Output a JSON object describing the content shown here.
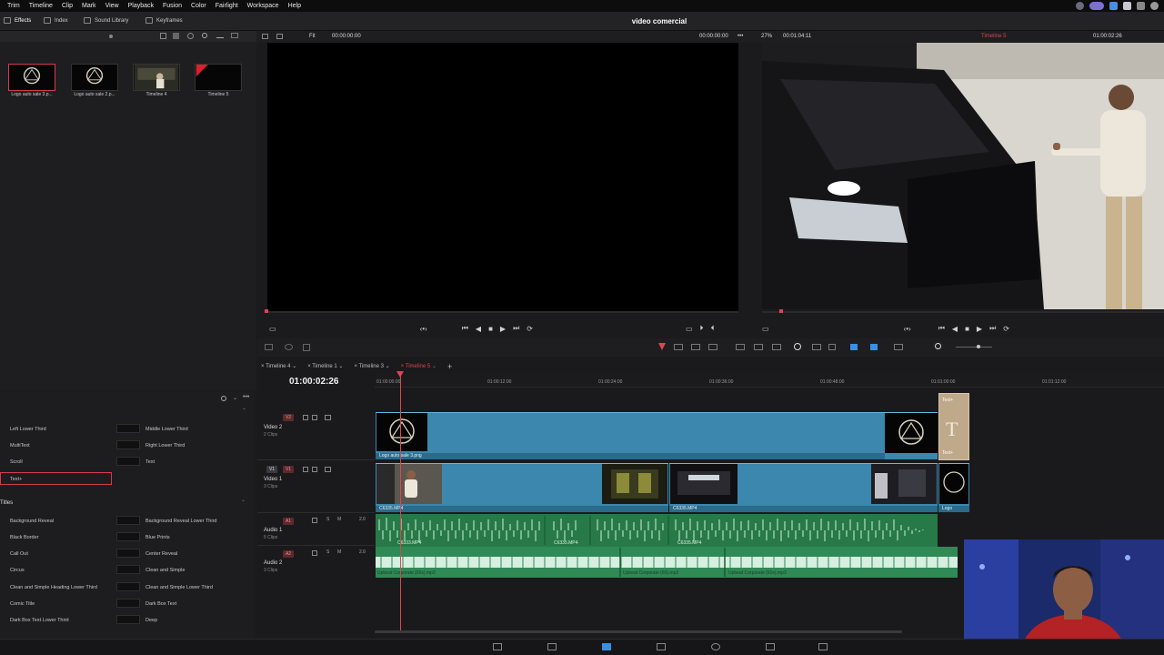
{
  "menu": [
    "Trim",
    "Timeline",
    "Clip",
    "Mark",
    "View",
    "Playback",
    "Fusion",
    "Color",
    "Fairlight",
    "Workspace",
    "Help"
  ],
  "toolbar": {
    "effects": "Effects",
    "index": "Index",
    "sound_library": "Sound Library",
    "keyframes": "Keyframes"
  },
  "project_title": "video comercial",
  "media_pool": {
    "clips": [
      {
        "label": "Logo auto sale 3.p..."
      },
      {
        "label": "Logo auto sale 2.p..."
      },
      {
        "label": "Timeline 4"
      },
      {
        "label": "Timeline 5"
      }
    ]
  },
  "viewer": {
    "fit": "Fit",
    "source_tc": "00:00:00:00",
    "prog_tc_left": "00:00:00:00",
    "zoom": "27%",
    "duration": "00:01:04:11",
    "timeline_name": "Timeline 5",
    "prog_tc": "01:00:02:26"
  },
  "timeline": {
    "tabs": [
      "Timeline 4",
      "Timeline 1",
      "Timeline 3",
      "Timeline 5"
    ],
    "active_tab": 3,
    "timecode": "01:00:02:26",
    "ruler": [
      "01:00:00:00",
      "01:00:12:00",
      "01:00:24:00",
      "01:00:36:00",
      "01:00:48:00",
      "01:01:00:00",
      "01:01:12:00"
    ],
    "tracks": {
      "v2": {
        "badge": "V2",
        "name": "Video 2",
        "sub": "2 Clips"
      },
      "v1": {
        "badge": "V1",
        "name": "Video 1",
        "sub": "3 Clips",
        "badge2": "V1"
      },
      "a1": {
        "badge": "A1",
        "name": "Audio 1",
        "sub": "5 Clips",
        "level": "2.0"
      },
      "a2": {
        "badge": "A2",
        "name": "Audio 2",
        "sub": "3 Clips",
        "level": "2.0"
      }
    },
    "clip_labels": {
      "v2_main": "Logo auto sale 3.png",
      "v2_text": "Text+",
      "v1_a": "C6335.MP4",
      "v1_b": "C6335.MP4",
      "v1_c": "Logo",
      "a1_a": "C6333.MP4",
      "a1_b": "C6335.MP4",
      "a1_c": "C6335.MP4",
      "a2_a": "Upbeat Corporate (60s).mp3",
      "a2_b": "Upbeat Corporate (60).mp3",
      "a2_c": "Upbeat Corporate (60s).mp3"
    }
  },
  "effects": {
    "generators": [
      {
        "left": "Left Lower Third",
        "right": "Middle Lower Third"
      },
      {
        "left": "MultiText",
        "right": "Right Lower Third"
      },
      {
        "left": "Scroll",
        "right": "Text"
      },
      {
        "left": "Text+",
        "right": ""
      }
    ],
    "titles_header": "Titles",
    "titles": [
      {
        "left": "Background Reveal",
        "right": "Background Reveal Lower Third"
      },
      {
        "left": "Black Border",
        "right": "Blue Prints"
      },
      {
        "left": "Call Out",
        "right": "Center Reveal"
      },
      {
        "left": "Circus",
        "right": "Clean and Simple"
      },
      {
        "left": "Clean and Simple Heading Lower Third",
        "right": "Clean and Simple Lower Third"
      },
      {
        "left": "Comic Title",
        "right": "Dark Box Text"
      },
      {
        "left": "Dark Box Text Lower Third",
        "right": "Deep"
      }
    ]
  },
  "colors": {
    "accent": "#e0444e",
    "video_clip": "#3b87ad",
    "audio_clip": "#2a7a4a"
  }
}
